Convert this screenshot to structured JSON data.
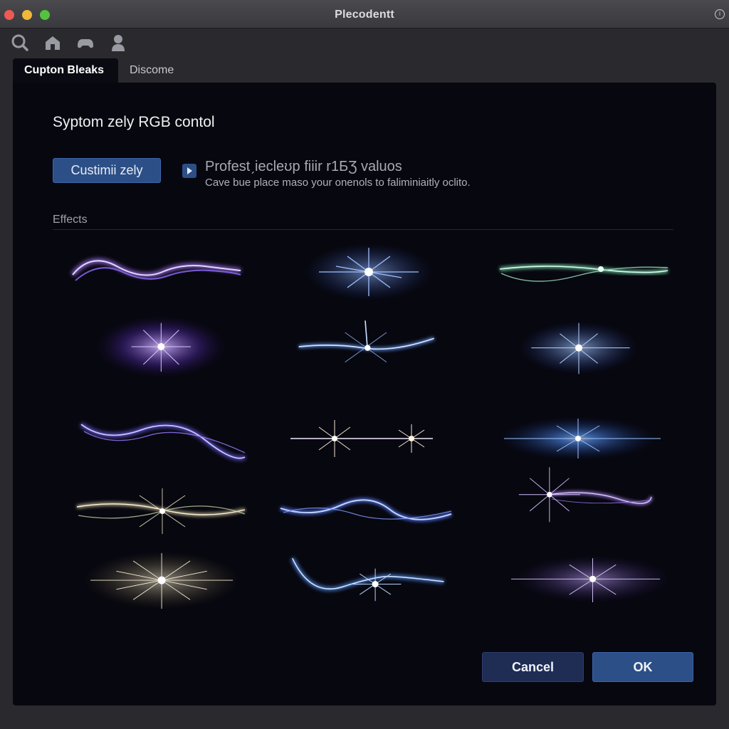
{
  "window": {
    "title": "Plecodentt"
  },
  "toolbar": {
    "icons": [
      "search-icon",
      "home-icon",
      "gamepad-icon",
      "user-icon"
    ]
  },
  "tabs": [
    {
      "label": "Cupton Bleaks",
      "active": true
    },
    {
      "label": "Discome",
      "active": false
    }
  ],
  "content": {
    "heading": "Syptom zely RGB contol",
    "customize_button": "Custimii zely",
    "description_title": "Profestˏiecleʊp fiiir r1БƷ valuos",
    "description_subtitle": "Cave bue place maso your onenols to faliminiaitly oclito.",
    "effects_label": "Effects"
  },
  "effects": [
    {
      "name": "purple-wave",
      "color": "#a97bff"
    },
    {
      "name": "blue-starburst",
      "color": "#5c8dff"
    },
    {
      "name": "green-wave",
      "color": "#7fe0b0"
    },
    {
      "name": "violet-starburst",
      "color": "#9a6bff"
    },
    {
      "name": "blue-wave-burst",
      "color": "#6aa0ff"
    },
    {
      "name": "blue-starburst-2",
      "color": "#6fa8ff"
    },
    {
      "name": "violet-wave",
      "color": "#7468ff"
    },
    {
      "name": "twin-sparkle",
      "color": "#e8d8ff"
    },
    {
      "name": "blue-sparkle-burst",
      "color": "#4f8fff"
    },
    {
      "name": "gold-wave-burst",
      "color": "#e8dcb0"
    },
    {
      "name": "blue-wave",
      "color": "#5a7dff"
    },
    {
      "name": "violet-wave-burst",
      "color": "#b48aff"
    },
    {
      "name": "gold-starburst",
      "color": "#f0e6c8"
    },
    {
      "name": "blue-wave-star",
      "color": "#5a9aff"
    },
    {
      "name": "lilac-starburst",
      "color": "#c0a0ff"
    }
  ],
  "actions": {
    "cancel": "Cancel",
    "ok": "OK"
  }
}
